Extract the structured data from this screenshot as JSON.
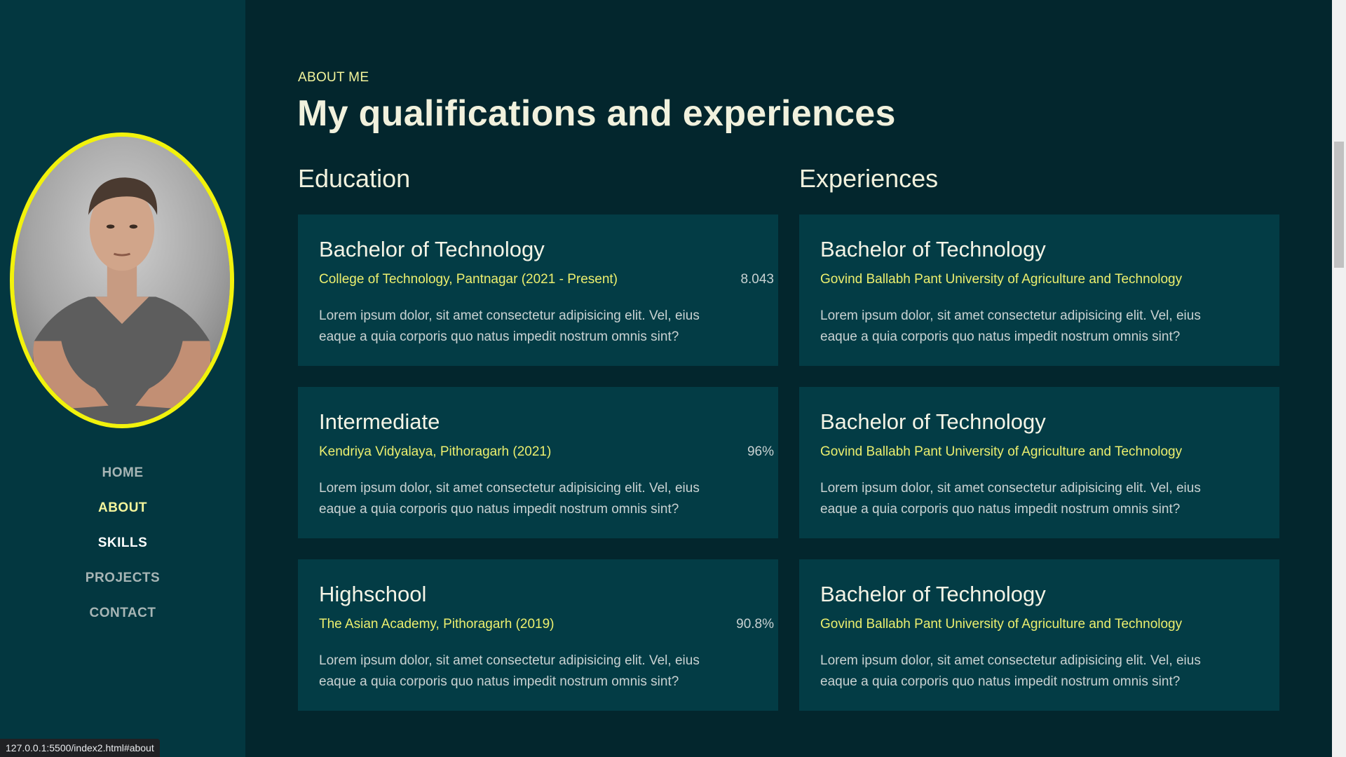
{
  "sidebar": {
    "nav": [
      "HOME",
      "ABOUT",
      "SKILLS",
      "PROJECTS",
      "CONTACT"
    ],
    "active_item": "ABOUT"
  },
  "section": {
    "eyebrow": "ABOUT ME",
    "title": "My qualifications and experiences"
  },
  "education": {
    "heading": "Education",
    "items": [
      {
        "title": "Bachelor of Technology",
        "subtitle": "College of Technology, Pantnagar (2021 - Present)",
        "score": "8.043",
        "description": "Lorem ipsum dolor, sit amet consectetur adipisicing elit. Vel, eius eaque a quia corporis quo natus impedit nostrum omnis sint?"
      },
      {
        "title": "Intermediate",
        "subtitle": "Kendriya Vidyalaya, Pithoragarh (2021)",
        "score": "96%",
        "description": "Lorem ipsum dolor, sit amet consectetur adipisicing elit. Vel, eius eaque a quia corporis quo natus impedit nostrum omnis sint?"
      },
      {
        "title": "Highschool",
        "subtitle": "The Asian Academy, Pithoragarh (2019)",
        "score": "90.8%",
        "description": "Lorem ipsum dolor, sit amet consectetur adipisicing elit. Vel, eius eaque a quia corporis quo natus impedit nostrum omnis sint?"
      }
    ]
  },
  "experiences": {
    "heading": "Experiences",
    "items": [
      {
        "title": "Bachelor of Technology",
        "subtitle": "Govind Ballabh Pant University of Agriculture and Technology",
        "description": "Lorem ipsum dolor, sit amet consectetur adipisicing elit. Vel, eius eaque a quia corporis quo natus impedit nostrum omnis sint?"
      },
      {
        "title": "Bachelor of Technology",
        "subtitle": "Govind Ballabh Pant University of Agriculture and Technology",
        "description": "Lorem ipsum dolor, sit amet consectetur adipisicing elit. Vel, eius eaque a quia corporis quo natus impedit nostrum omnis sint?"
      },
      {
        "title": "Bachelor of Technology",
        "subtitle": "Govind Ballabh Pant University of Agriculture and Technology",
        "description": "Lorem ipsum dolor, sit amet consectetur adipisicing elit. Vel, eius eaque a quia corporis quo natus impedit nostrum omnis sint?"
      }
    ]
  },
  "status_bar": {
    "url": "127.0.0.1:5500/index2.html#about"
  },
  "colors": {
    "sidebar_bg": "#033740",
    "main_bg": "#03262d",
    "card_bg": "#033c45",
    "accent_yellow": "#f4f59c",
    "avatar_border": "#f2f20c"
  }
}
